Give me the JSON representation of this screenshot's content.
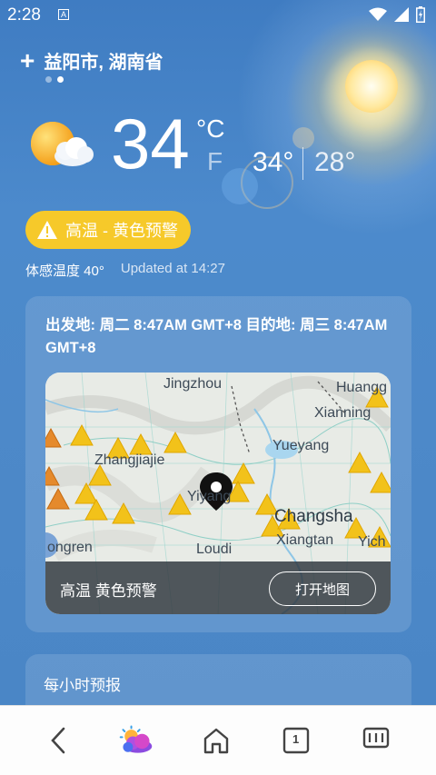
{
  "status_bar": {
    "time": "2:28",
    "app_icon": "A",
    "icons": [
      "wifi-icon",
      "signal-icon",
      "battery-icon"
    ]
  },
  "header": {
    "add_icon": "+",
    "location": "益阳市, 湖南省",
    "page_dots": 2,
    "active_dot": 1
  },
  "current": {
    "weather_icon": "sun-cloud-icon",
    "temperature": "34",
    "unit_c": "°C",
    "unit_f": "F",
    "high": "34°",
    "low": "28°"
  },
  "alert": {
    "text": "高温 - 黄色预警",
    "color": "#f6c92a"
  },
  "details": {
    "feels_like": "体感温度 40°",
    "updated": "Updated at 14:27"
  },
  "route_card": {
    "text": "出发地: 周二 8:47AM GMT+8 目的地: 周三 8:47AM GMT+8",
    "map_labels": {
      "jingzhou": "Jingzhou",
      "huanggang": "Huangg",
      "xianning": "Xianning",
      "zhangjiajie": "Zhangjiajie",
      "yueyang": "Yueyang",
      "yiyang": "Yiyang",
      "changsha": "Changsha",
      "xiangtan": "Xiangtan",
      "loudi": "Loudi",
      "yichun": "Yich",
      "rongren": "ongren"
    },
    "footer_text": "高温 黄色预警",
    "open_map_button": "打开地图"
  },
  "hourly_card": {
    "title": "每小时预报"
  },
  "nav": {
    "items": [
      "back-icon",
      "weather-app-icon",
      "home-icon",
      "tabs-icon",
      "menu-icon"
    ],
    "tab_count": "1"
  }
}
